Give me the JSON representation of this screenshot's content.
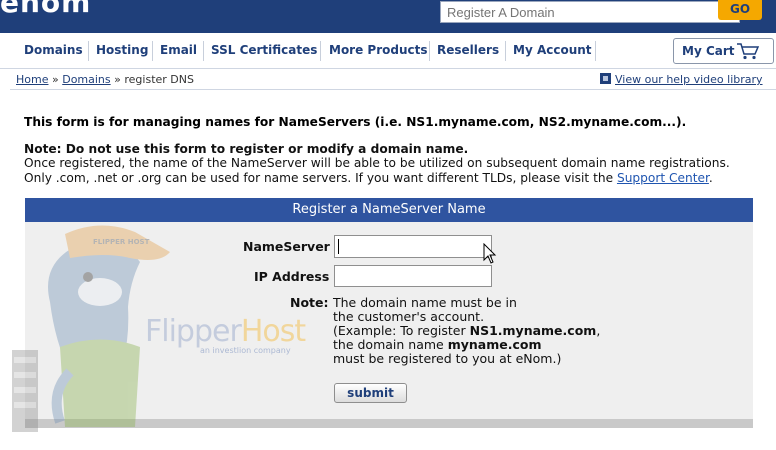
{
  "header": {
    "logo_text": "enom",
    "search": {
      "placeholder": "Register A Domain",
      "value": ""
    },
    "go_label": "GO"
  },
  "nav": {
    "items": [
      {
        "label": "Domains"
      },
      {
        "label": "Hosting"
      },
      {
        "label": "Email"
      },
      {
        "label": "SSL Certificates"
      },
      {
        "label": "More Products"
      },
      {
        "label": "Resellers"
      },
      {
        "label": "My Account"
      }
    ],
    "cart_label": "My Cart",
    "cart_icon": "shopping-cart-icon"
  },
  "breadcrumb": {
    "home": "Home",
    "sep1": " » ",
    "domains": "Domains",
    "sep2": " » ",
    "current": "register DNS"
  },
  "help": {
    "icon": "film-icon",
    "label": "View our help video library"
  },
  "intro": {
    "text": "This form is for managing names for NameServers (i.e. NS1.myname.com, NS2.myname.com...).",
    "note_title": "Note: Do not use this form to register or modify a domain name.",
    "line1": "Once registered, the name of the NameServer will be able to be utilized on subsequent domain name registrations.",
    "line2_pre": "Only .com, .net or .org can be used for name servers. If you want different TLDs, please visit the ",
    "line2_link": "Support Center",
    "line2_post": "."
  },
  "form": {
    "title": "Register a NameServer Name",
    "nameserver_label": "NameServer",
    "nameserver_value": "",
    "ip_label": "IP Address",
    "ip_value": "",
    "note_label": "Note:",
    "note_lines": {
      "l1": "The domain name must be in",
      "l2": "the customer's account.",
      "l3_pre": "(Example: To register ",
      "l3_bold": "NS1.myname.com",
      "l3_post": ",",
      "l4_pre": "the domain name ",
      "l4_bold": "myname.com",
      "l5": "must be registered to you at eNom.)"
    },
    "submit_label": "submit"
  },
  "watermark": {
    "brand_a": "Flipper",
    "brand_b": "Host",
    "tagline": "an investlion company",
    "cap_text": "FLIPPER HOST"
  },
  "colors": {
    "brand_blue": "#1f3f7a",
    "panel_blue": "#2f54a0",
    "accent_orange": "#f5a800",
    "panel_bg": "#efefef"
  }
}
